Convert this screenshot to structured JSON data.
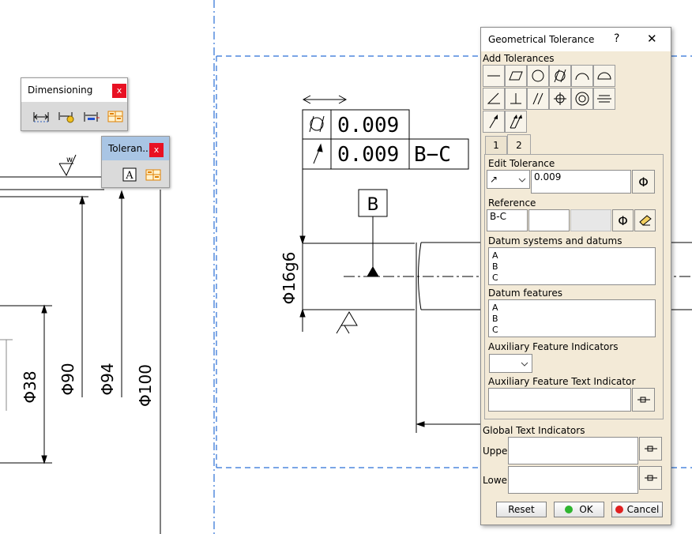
{
  "drawing": {
    "dim_labels": {
      "d38": "Φ38",
      "d90": "Φ90",
      "d94": "Φ94",
      "d100": "Φ100",
      "d16": "Φ16g6"
    },
    "fcf": {
      "row1_value": "0.009",
      "row2_value": "0.009",
      "row2_datum": "B−C"
    },
    "datum_label": "B",
    "roughness_label": "w"
  },
  "toolbar_dimensioning": {
    "title": "Dimensioning",
    "close": "x"
  },
  "toolbar_tolerance": {
    "title": "Toleran...",
    "close": "x",
    "datum_icon_text": "A"
  },
  "dialog": {
    "title": "Geometrical Tolerance",
    "help": "?",
    "close": "✕",
    "add_tolerances_label": "Add Tolerances",
    "tabs": [
      "1",
      "2"
    ],
    "edit_tolerance_label": "Edit Tolerance",
    "tolerance_symbol": "↗",
    "tolerance_value": "0.009",
    "diameter_symbol": "Φ",
    "reference_label": "Reference",
    "reference_value": "B-C",
    "datum_systems_label": "Datum systems and datums",
    "datum_systems": [
      "A",
      "B",
      "C"
    ],
    "datum_features_label": "Datum features",
    "datum_features": [
      "A",
      "B",
      "C"
    ],
    "aux_indicators_label": "Auxiliary Feature Indicators",
    "aux_text_label": "Auxiliary Feature Text Indicator",
    "global_text_label": "Global Text Indicators",
    "upper_label": "Upper",
    "lower_label": "Lower",
    "reset_label": "Reset",
    "ok_label": "OK",
    "cancel_label": "Cancel",
    "colors": {
      "ok_led": "#2fb52f",
      "cancel_led": "#e02020",
      "background": "#f3ead7"
    }
  }
}
